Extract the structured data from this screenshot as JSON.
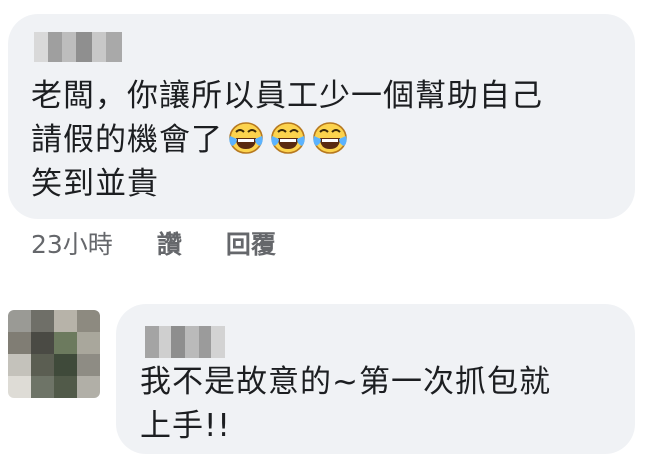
{
  "comment1": {
    "lines": [
      "老闆，你讓所以員工少一個幫助自己",
      "請假的機會了",
      "笑到並貴"
    ],
    "emojis": [
      "laughing-tears-emoji",
      "laughing-tears-emoji",
      "laughing-tears-emoji"
    ],
    "time": "23小時",
    "like_label": "讚",
    "reply_label": "回覆"
  },
  "comment2": {
    "lines": [
      "我不是故意的~第一次抓包就",
      "上手!!"
    ]
  },
  "colors": {
    "bubble": "#f0f2f5",
    "meta_text": "#65676b",
    "text": "#1c1e21"
  }
}
